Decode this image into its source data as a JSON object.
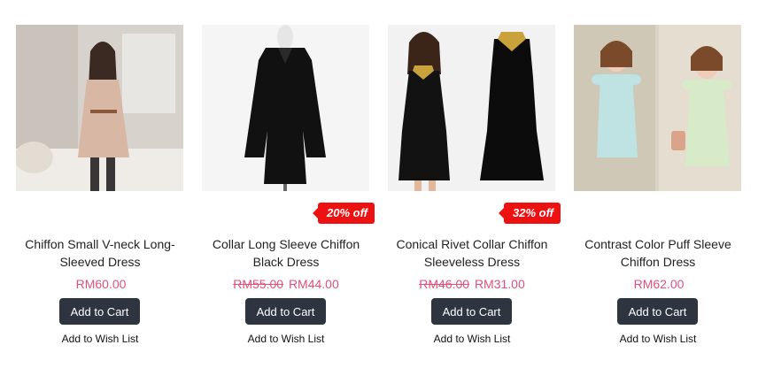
{
  "products": [
    {
      "name": "Chiffon Small V-neck Long-Sleeved Dress",
      "price": "RM60.00",
      "old_price": null,
      "discount": null,
      "cart_label": "Add to Cart",
      "wish_label": "Add to Wish List",
      "image": "beige-chiffon-dress-photo"
    },
    {
      "name": "Collar Long Sleeve Chiffon Black Dress",
      "price": "RM44.00",
      "old_price": "RM55.00",
      "discount": "20% off",
      "cart_label": "Add to Cart",
      "wish_label": "Add to Wish List",
      "image": "black-long-sleeve-dress-photo"
    },
    {
      "name": "Conical Rivet Collar Chiffon Sleeveless Dress",
      "price": "RM31.00",
      "old_price": "RM46.00",
      "discount": "32% off",
      "cart_label": "Add to Cart",
      "wish_label": "Add to Wish List",
      "image": "black-sleeveless-rivet-dress-photo"
    },
    {
      "name": "Contrast Color Puff Sleeve Chiffon Dress",
      "price": "RM62.00",
      "old_price": null,
      "discount": null,
      "cart_label": "Add to Cart",
      "wish_label": "Add to Wish List",
      "image": "puff-sleeve-pastel-dress-photo"
    }
  ],
  "colors": {
    "price": "#e0507a",
    "badge": "#ee1111",
    "button": "#2e3540"
  }
}
